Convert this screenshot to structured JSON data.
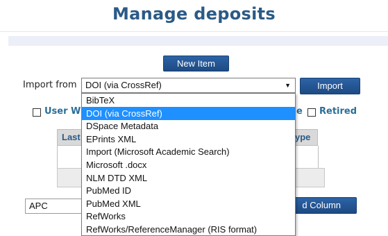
{
  "page": {
    "title": "Manage deposits"
  },
  "toolbar": {
    "new_item_label": "New Item"
  },
  "import_form": {
    "label": "Import from",
    "selected_value": "DOI (via CrossRef)",
    "import_button_label": "Import",
    "options": [
      "BibTeX",
      "DOI (via CrossRef)",
      "DSpace Metadata",
      "EPrints XML",
      "Import (Microsoft Academic Search)",
      "Microsoft .docx",
      "NLM DTD XML",
      "PubMed ID",
      "PubMed XML",
      "RefWorks",
      "RefWorks/ReferenceManager (RIS format)"
    ],
    "highlighted_index": 1
  },
  "filters": {
    "user_label_partial": "User W",
    "middle_label_partial": "e",
    "retired_label": "Retired"
  },
  "table": {
    "col_left_partial": "Last",
    "col_right_partial": "ype"
  },
  "column_adder": {
    "input_value": "APC",
    "button_label_partial": "d Column"
  },
  "colors": {
    "title": "#2b5a86",
    "button": "#1f4f8c",
    "highlight": "#1e90ff",
    "label_link": "#2a6e98"
  }
}
